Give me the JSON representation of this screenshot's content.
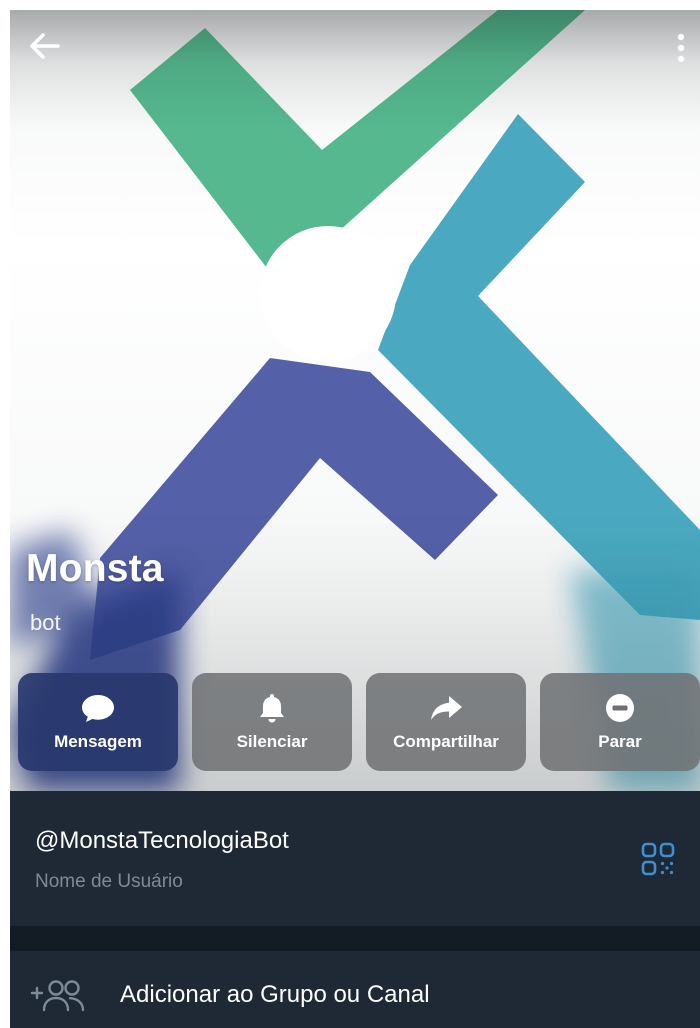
{
  "header": {
    "back_icon": "arrow-left-icon",
    "menu_icon": "more-vertical-icon"
  },
  "profile": {
    "name": "Monsta",
    "status": "bot",
    "photo_colors": {
      "green": "#55b88e",
      "teal": "#4aa9c0",
      "indigo": "#5461a8",
      "accent": "#3d8fd0"
    }
  },
  "actions": [
    {
      "label": "Mensagem",
      "icon": "message-bubble-icon"
    },
    {
      "label": "Silenciar",
      "icon": "bell-icon"
    },
    {
      "label": "Compartilhar",
      "icon": "share-arrow-icon"
    },
    {
      "label": "Parar",
      "icon": "stop-minus-icon"
    }
  ],
  "info": {
    "username": "@MonstaTecnologiaBot",
    "username_caption": "Nome de Usuário",
    "qr_icon": "qr-code-icon"
  },
  "add_to_group": {
    "label": "Adicionar ao Grupo ou Canal",
    "icon": "add-users-icon"
  },
  "theme": {
    "panel_bg": "#1e2935",
    "divider_bg": "#131b24",
    "caption_color": "#7d8b99",
    "link_color": "#3d8fd0"
  }
}
